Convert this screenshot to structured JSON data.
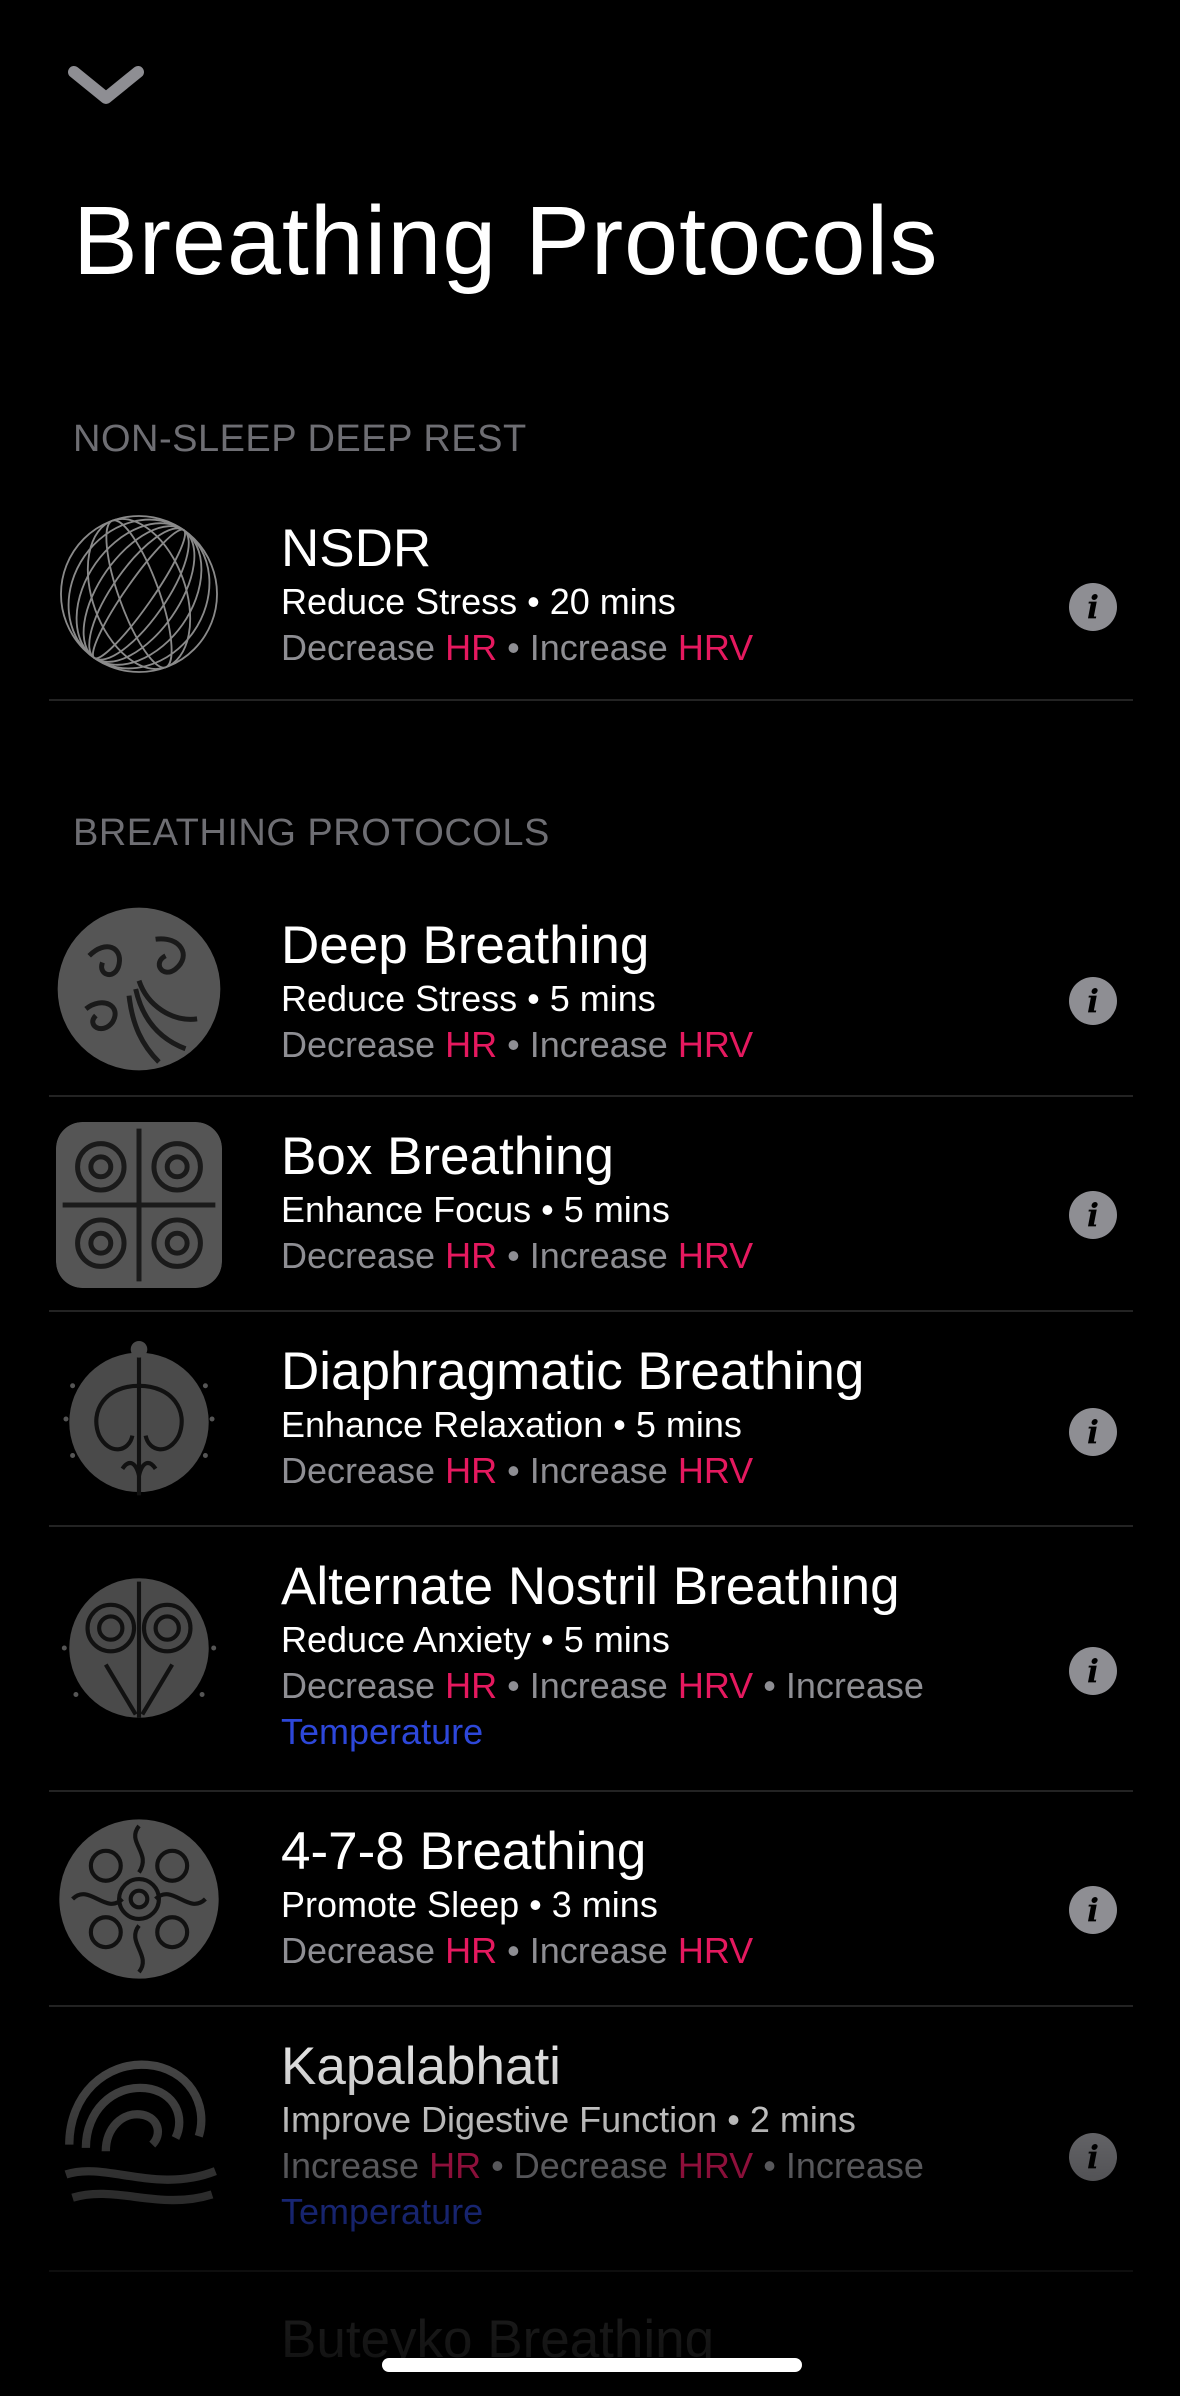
{
  "header": {
    "title": "Breathing Protocols",
    "dismiss_icon": "chevron-down-icon"
  },
  "sections": [
    {
      "label": "NON-SLEEP DEEP REST"
    },
    {
      "label": "BREATHING PROTOCOLS"
    }
  ],
  "protocols": [
    {
      "name": "NSDR",
      "goal": "Reduce Stress",
      "duration": "20 mins",
      "m1": "Decrease",
      "m1k": "HR",
      "m2": "Increase",
      "m2k": "HRV"
    },
    {
      "name": "Deep Breathing",
      "goal": "Reduce Stress",
      "duration": "5 mins",
      "m1": "Decrease",
      "m1k": "HR",
      "m2": "Increase",
      "m2k": "HRV"
    },
    {
      "name": "Box Breathing",
      "goal": "Enhance Focus",
      "duration": "5 mins",
      "m1": "Decrease",
      "m1k": "HR",
      "m2": "Increase",
      "m2k": "HRV"
    },
    {
      "name": "Diaphragmatic Breathing",
      "goal": "Enhance Relaxation",
      "duration": "5 mins",
      "m1": "Decrease",
      "m1k": "HR",
      "m2": "Increase",
      "m2k": "HRV"
    },
    {
      "name": "Alternate Nostril Breathing",
      "goal": "Reduce Anxiety",
      "duration": "5 mins",
      "m1": "Decrease",
      "m1k": "HR",
      "m2": "Increase",
      "m2k": "HRV",
      "m3": "Increase",
      "m3k": "Temperature"
    },
    {
      "name": "4-7-8 Breathing",
      "goal": "Promote Sleep",
      "duration": "3 mins",
      "m1": "Decrease",
      "m1k": "HR",
      "m2": "Increase",
      "m2k": "HRV"
    },
    {
      "name": "Kapalabhati",
      "goal": "Improve Digestive Function",
      "duration": "2 mins",
      "m1": "Increase",
      "m1k": "HR",
      "m2": "Decrease",
      "m2k": "HRV",
      "m3": "Increase",
      "m3k": "Temperature"
    },
    {
      "name": "Buteyko Breathing"
    }
  ],
  "separator": "•",
  "info_icon": "info-icon",
  "colors": {
    "accent_red": "#e5195f",
    "accent_blue": "#2d47d9",
    "secondary": "#8e8e93"
  }
}
